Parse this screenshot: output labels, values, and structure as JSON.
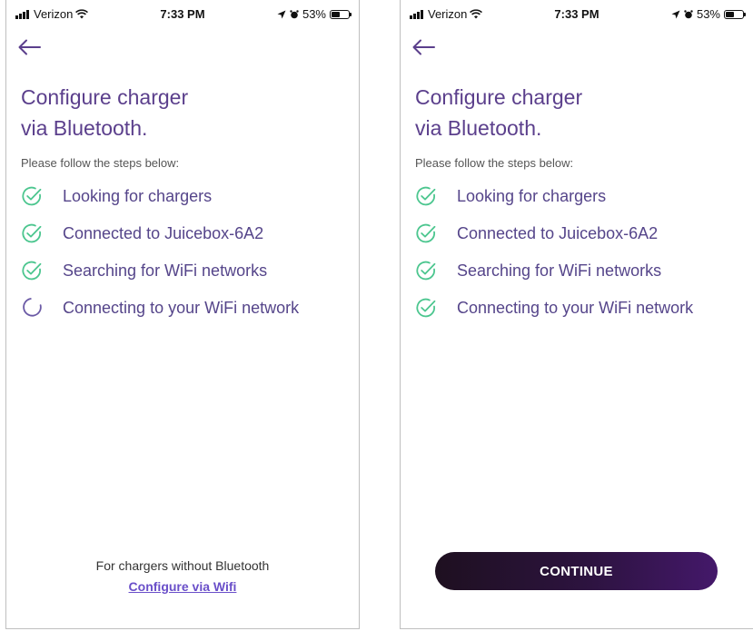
{
  "status_bar": {
    "carrier": "Verizon",
    "time": "7:33 PM",
    "battery": "53%"
  },
  "title_line1": "Configure charger",
  "title_line2": "via Bluetooth.",
  "subtitle": "Please follow the steps below:",
  "screens": {
    "left": {
      "steps": [
        {
          "label": "Looking for chargers",
          "state": "done"
        },
        {
          "label": "Connected to Juicebox-6A2",
          "state": "done"
        },
        {
          "label": "Searching for WiFi networks",
          "state": "done"
        },
        {
          "label": "Connecting to your WiFi network",
          "state": "in-progress"
        }
      ],
      "footer_note": "For chargers without Bluetooth",
      "footer_link": "Configure via Wifi"
    },
    "right": {
      "steps": [
        {
          "label": "Looking for chargers",
          "state": "done"
        },
        {
          "label": "Connected to Juicebox-6A2",
          "state": "done"
        },
        {
          "label": "Searching for WiFi networks",
          "state": "done"
        },
        {
          "label": "Connecting to your WiFi network",
          "state": "done"
        }
      ],
      "continue_label": "CONTINUE"
    }
  },
  "colors": {
    "accent": "#5b3f8c",
    "check": "#4cc68f",
    "spinner": "#6b5aa6",
    "link": "#6a4fc9"
  }
}
